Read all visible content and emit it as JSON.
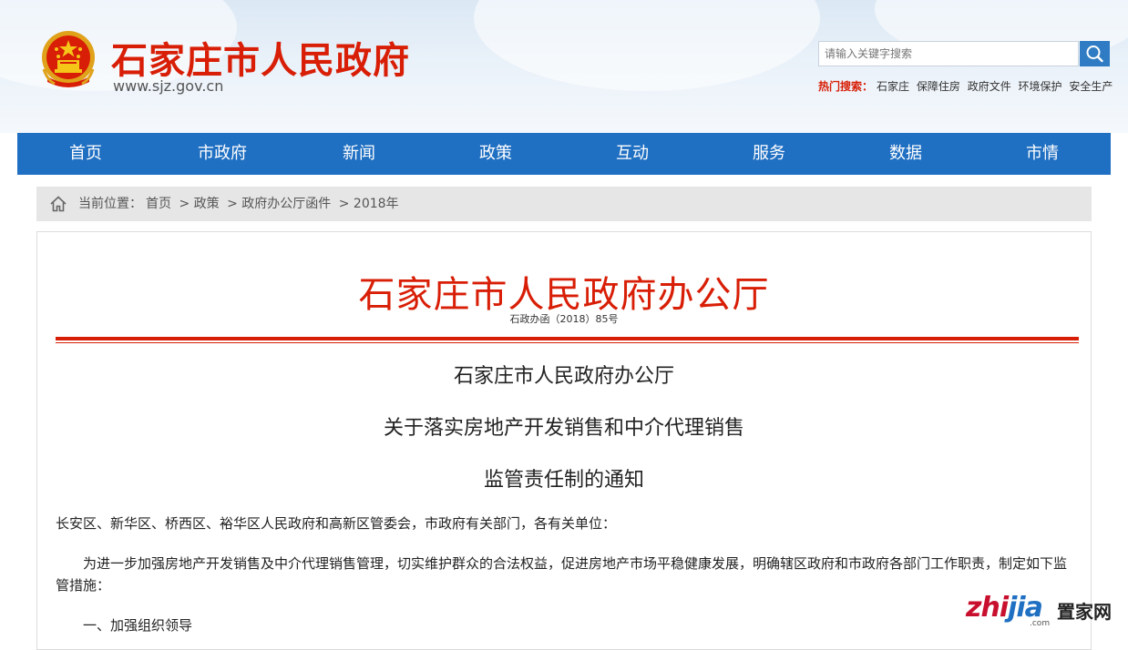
{
  "header": {
    "site_title": "石家庄市人民政府",
    "site_url": "www.sjz.gov.cn",
    "search_placeholder": "请输入关键字搜索",
    "hot_label": "热门搜索：",
    "hot_items": [
      "石家庄",
      "保障住房",
      "政府文件",
      "环境保护",
      "安全生产"
    ]
  },
  "nav": {
    "items": [
      "首页",
      "市政府",
      "新闻",
      "政策",
      "互动",
      "服务",
      "数据",
      "市情"
    ]
  },
  "breadcrumb": {
    "prefix": "当前位置：",
    "items": [
      "首页",
      "> 政策",
      "> 政府办公厅函件",
      "> 2018年"
    ]
  },
  "article": {
    "issuer": "石家庄市人民政府办公厅",
    "doc_number": "石政办函（2018）85号",
    "title_line1": "石家庄市人民政府办公厅",
    "title_line2": "关于落实房地产开发销售和中介代理销售",
    "title_line3": "监管责任制的通知",
    "addressee": "长安区、新华区、桥西区、裕华区人民政府和高新区管委会，市政府有关部门，各有关单位：",
    "intro": "为进一步加强房地产开发销售及中介代理销售管理，切实维护群众的合法权益，促进房地产市场平稳健康发展，明确辖区政府和市政府各部门工作职责，制定如下监管措施：",
    "section1": "一、加强组织领导"
  },
  "watermark": {
    "brand_a": "zhi",
    "brand_b": "jia",
    "cn": "置家网",
    "com": ".com"
  },
  "colors": {
    "brand_red": "#d81e06",
    "nav_blue": "#1f6fc2"
  }
}
